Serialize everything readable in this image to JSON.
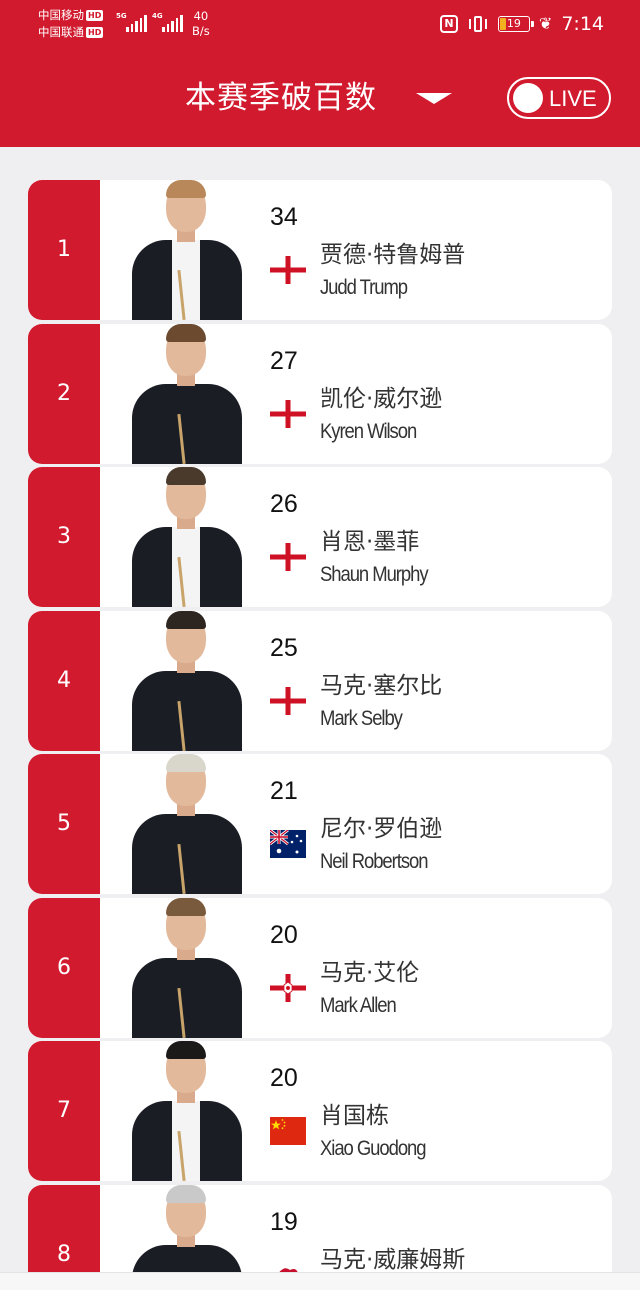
{
  "status_bar": {
    "carrier1": "中国移动",
    "carrier2": "中国联通",
    "hd_badge": "HD",
    "signal1_tag": "5G",
    "signal2_tag": "4G",
    "net_speed_value": "40",
    "net_speed_unit": "B/s",
    "nfc_label": "N",
    "battery_level": "19",
    "leaf_icon": "leaf-icon",
    "time": "7:14"
  },
  "header": {
    "title": "本赛季破百数",
    "live_label": "LIVE"
  },
  "colors": {
    "accent": "#d11a2e",
    "background": "#efeff1"
  },
  "players": [
    {
      "rank": "1",
      "score": "34",
      "name_cn": "贾德·特鲁姆普",
      "name_en": "Judd Trump",
      "flag": "england-flag",
      "attire": "vest",
      "hair": "#b9885a"
    },
    {
      "rank": "2",
      "score": "27",
      "name_cn": "凯伦·威尔逊",
      "name_en": "Kyren Wilson",
      "flag": "england-flag",
      "attire": "shirt",
      "hair": "#6b4a2f"
    },
    {
      "rank": "3",
      "score": "26",
      "name_cn": "肖恩·墨菲",
      "name_en": "Shaun Murphy",
      "flag": "england-flag",
      "attire": "vest",
      "hair": "#4a3a2c"
    },
    {
      "rank": "4",
      "score": "25",
      "name_cn": "马克·塞尔比",
      "name_en": "Mark Selby",
      "flag": "england-flag",
      "attire": "shirt",
      "hair": "#2d2520"
    },
    {
      "rank": "5",
      "score": "21",
      "name_cn": "尼尔·罗伯逊",
      "name_en": "Neil Robertson",
      "flag": "australia-flag",
      "attire": "shirt",
      "hair": "#d9d6cc"
    },
    {
      "rank": "6",
      "score": "20",
      "name_cn": "马克·艾伦",
      "name_en": "Mark Allen",
      "flag": "northern-ireland-flag",
      "attire": "shirt",
      "hair": "#7a5a3c"
    },
    {
      "rank": "7",
      "score": "20",
      "name_cn": "肖国栋",
      "name_en": "Xiao Guodong",
      "flag": "china-flag",
      "attire": "vest",
      "hair": "#1c1a18"
    },
    {
      "rank": "8",
      "score": "19",
      "name_cn": "马克·威廉姆斯",
      "name_en": "",
      "flag": "wales-flag",
      "attire": "shirt",
      "hair": "#c9c9c9"
    }
  ]
}
